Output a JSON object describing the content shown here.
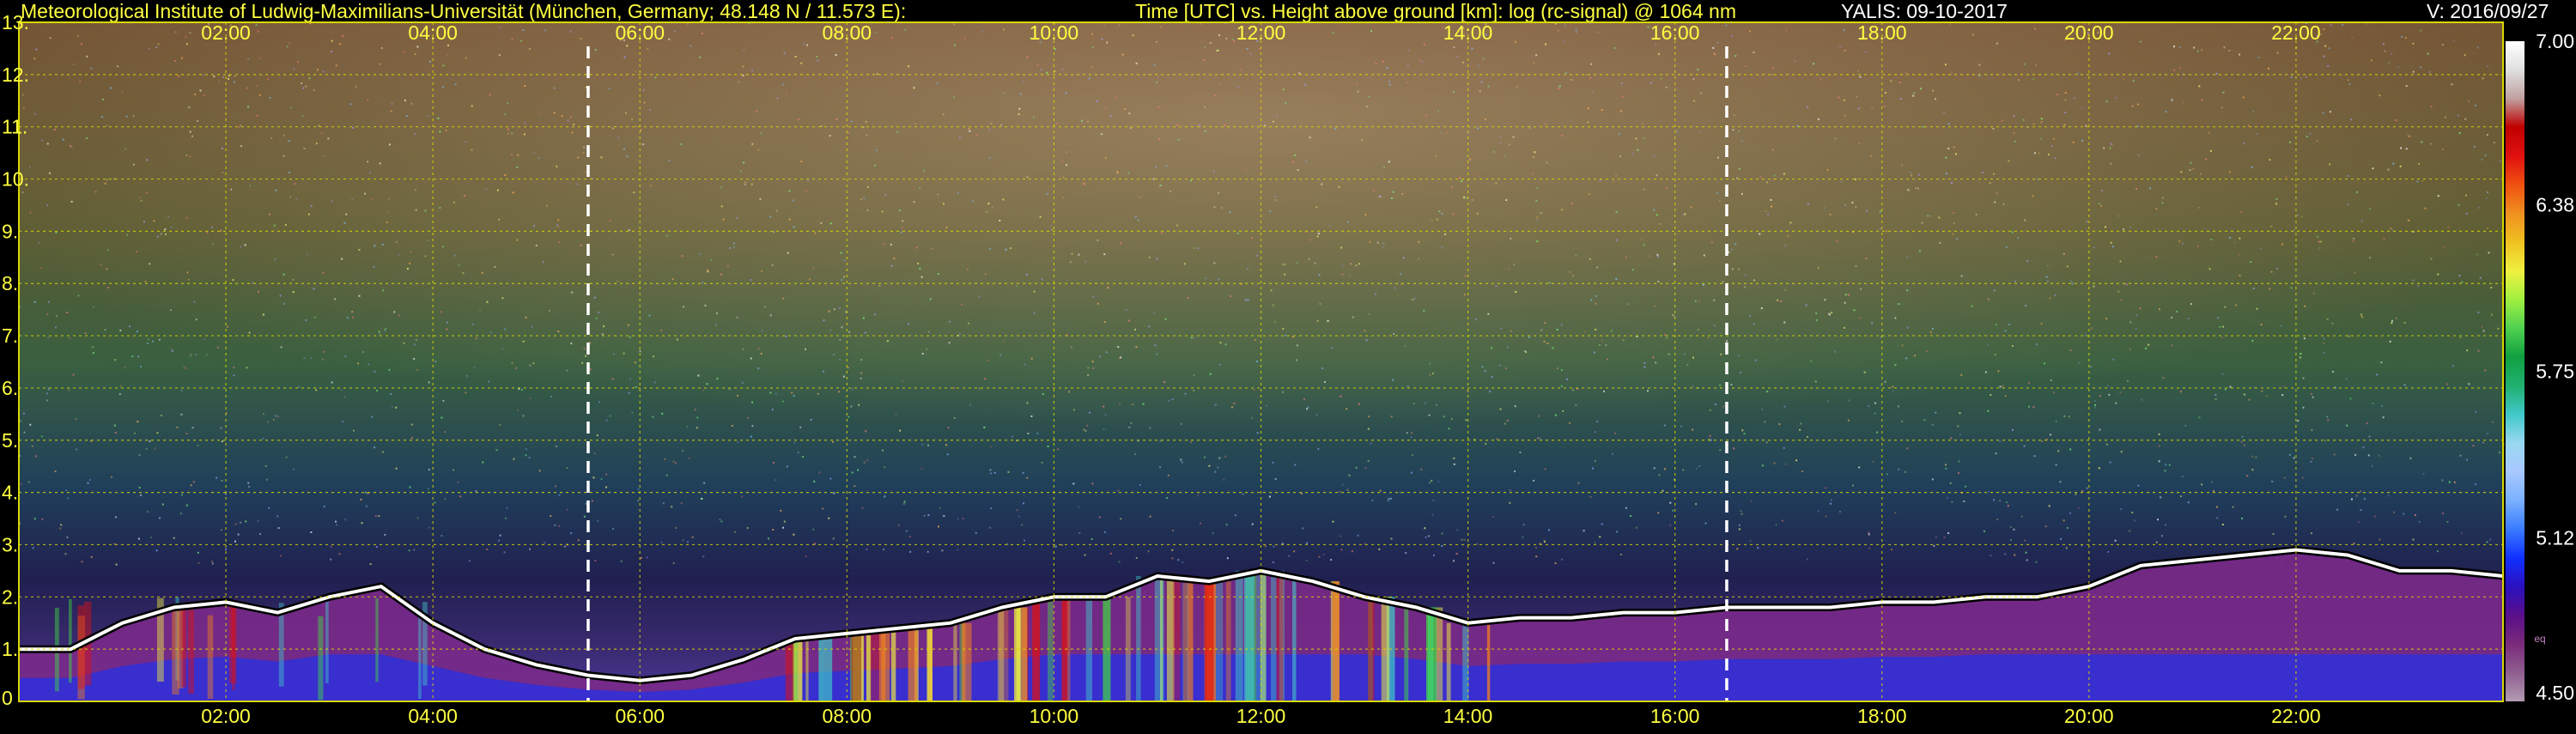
{
  "header": {
    "institute": "Meteorological Institute of Ludwig-Maximilians-Universität (München, Germany; 48.148 N / 11.573 E):",
    "description": "Time [UTC] vs. Height above ground [km]: log (rc-signal) @ 1064 nm",
    "instrument_date": "YALIS: 09-10-2017",
    "version": "V: 2016/09/27"
  },
  "chart_data": {
    "type": "heatmap",
    "title": "Time [UTC] vs. Height above ground [km]: log (rc-signal) @ 1064 nm",
    "x_axis": {
      "unit": "UTC hour",
      "range": [
        0,
        24
      ],
      "ticks": [
        2,
        4,
        6,
        8,
        10,
        12,
        14,
        16,
        18,
        20,
        22
      ],
      "tick_labels": [
        "02:00",
        "04:00",
        "06:00",
        "08:00",
        "10:00",
        "12:00",
        "14:00",
        "16:00",
        "18:00",
        "20:00",
        "22:00"
      ]
    },
    "y_axis": {
      "unit": "km",
      "range": [
        0,
        13
      ],
      "ticks": [
        0,
        1,
        2,
        3,
        4,
        5,
        6,
        7,
        8,
        9,
        10,
        11,
        12,
        13
      ],
      "tick_labels": [
        "0",
        "1.",
        "2.",
        "3.",
        "4.",
        "5.",
        "6.",
        "7.",
        "8.",
        "9.",
        "10.",
        "11.",
        "12.",
        "13."
      ]
    },
    "grid": true,
    "vertical_markers_utc": [
      5.5,
      16.5
    ],
    "colorbar": {
      "range": [
        4.5,
        7.0
      ],
      "tick_values": [
        7.0,
        6.38,
        5.75,
        5.12,
        4.5
      ],
      "tick_labels": [
        "7.00",
        "6.38",
        "5.75",
        "5.12",
        "4.50"
      ],
      "small_label": "eq",
      "colors": [
        "#b39bb3",
        "#8f5f8f",
        "#7a2a7a",
        "#5a0f8a",
        "#2a10c0",
        "#1030ff",
        "#3a7cff",
        "#7ab0ff",
        "#a8c8ff",
        "#9ad8f0",
        "#40c8c8",
        "#20b070",
        "#10a040",
        "#50d050",
        "#a0f040",
        "#f0f040",
        "#f0c020",
        "#f09020",
        "#f05010",
        "#e01010",
        "#c00000",
        "#c0a0a0",
        "#e0e0e0",
        "#ffffff"
      ]
    },
    "boundary_layer_top_km": [
      [
        0.0,
        1.0
      ],
      [
        0.5,
        1.0
      ],
      [
        1.0,
        1.5
      ],
      [
        1.5,
        1.8
      ],
      [
        2.0,
        1.9
      ],
      [
        2.5,
        1.7
      ],
      [
        3.0,
        2.0
      ],
      [
        3.5,
        2.2
      ],
      [
        4.0,
        1.5
      ],
      [
        4.5,
        1.0
      ],
      [
        5.0,
        0.7
      ],
      [
        5.5,
        0.5
      ],
      [
        6.0,
        0.4
      ],
      [
        6.5,
        0.5
      ],
      [
        7.0,
        0.8
      ],
      [
        7.5,
        1.2
      ],
      [
        8.0,
        1.3
      ],
      [
        8.5,
        1.4
      ],
      [
        9.0,
        1.5
      ],
      [
        9.5,
        1.8
      ],
      [
        10.0,
        2.0
      ],
      [
        10.5,
        2.0
      ],
      [
        11.0,
        2.4
      ],
      [
        11.5,
        2.3
      ],
      [
        12.0,
        2.5
      ],
      [
        12.5,
        2.3
      ],
      [
        13.0,
        2.0
      ],
      [
        13.5,
        1.8
      ],
      [
        14.0,
        1.5
      ],
      [
        14.5,
        1.6
      ],
      [
        15.0,
        1.6
      ],
      [
        15.5,
        1.7
      ],
      [
        16.0,
        1.7
      ],
      [
        16.5,
        1.8
      ],
      [
        17.0,
        1.8
      ],
      [
        17.5,
        1.8
      ],
      [
        18.0,
        1.9
      ],
      [
        18.5,
        1.9
      ],
      [
        19.0,
        2.0
      ],
      [
        19.5,
        2.0
      ],
      [
        20.0,
        2.2
      ],
      [
        20.5,
        2.6
      ],
      [
        21.0,
        2.7
      ],
      [
        21.5,
        2.8
      ],
      [
        22.0,
        2.9
      ],
      [
        22.5,
        2.8
      ],
      [
        23.0,
        2.5
      ],
      [
        23.5,
        2.5
      ],
      [
        24.0,
        2.4
      ]
    ]
  }
}
